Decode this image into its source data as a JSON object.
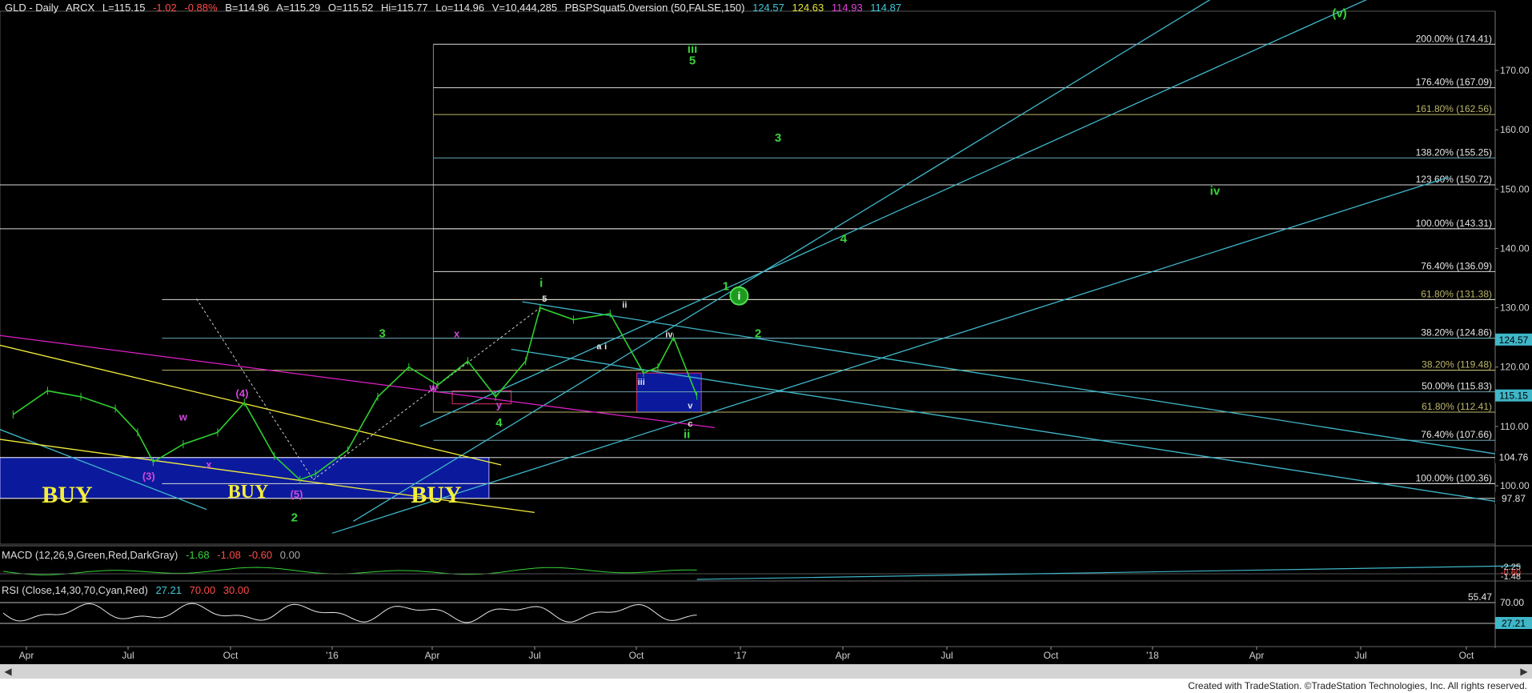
{
  "header": {
    "symbol": "GLD - Daily",
    "exchange": "ARCX",
    "last": "L=115.15",
    "change": "-1.02",
    "change_pct": "-0.88%",
    "bid": "B=114.96",
    "ask": "A=115.29",
    "open": "O=115.52",
    "high": "Hi=115.77",
    "low": "Lo=114.96",
    "volume": "V=10,444,285",
    "indicator": "PBSPSquat5.0version (50,FALSE,150)",
    "ind_values": [
      "124.57",
      "124.63",
      "114.93",
      "114.87"
    ]
  },
  "colors": {
    "background": "#000000",
    "price_bars": "#2fd02f",
    "channel": "#3fb7c9",
    "fib_white": "#d9d9d9",
    "fib_gold": "#bdb76b",
    "trend_yellow": "#f4ee3a",
    "trend_magenta": "#e020c8",
    "buy_box": "#0b1a9c",
    "wave_green": "#39d439",
    "wave_magenta": "#d04ad8",
    "rsi_line": "#e6e6e6"
  },
  "chart_data": {
    "type": "line",
    "title": "GLD - Daily",
    "series": [
      {
        "name": "GLD",
        "x": [
          "2015-03-20",
          "2015-04-20",
          "2015-05-20",
          "2015-06-20",
          "2015-07-10",
          "2015-07-24",
          "2015-08-20",
          "2015-09-20",
          "2015-10-14",
          "2015-11-10",
          "2015-12-03",
          "2015-12-17",
          "2016-01-15",
          "2016-02-11",
          "2016-03-10",
          "2016-04-05",
          "2016-05-02",
          "2016-05-27",
          "2016-06-23",
          "2016-07-06",
          "2016-08-05",
          "2016-09-07",
          "2016-10-07",
          "2016-10-20",
          "2016-11-03",
          "2016-11-24"
        ],
        "values": [
          112,
          116,
          115,
          113,
          109,
          104,
          107,
          109,
          114,
          105,
          101,
          102,
          106,
          115,
          120,
          117,
          121,
          115,
          121,
          130,
          128,
          129,
          119,
          120,
          125,
          115.15
        ]
      }
    ],
    "xlabel": "",
    "ylabel": "",
    "ylim": [
      90,
      180
    ],
    "x_ticks": [
      "Apr",
      "Jul",
      "Oct",
      "'16",
      "Apr",
      "Jul",
      "Oct",
      "'17",
      "Apr",
      "Jul",
      "Oct",
      "'18",
      "Apr",
      "Jul",
      "Oct"
    ],
    "y_ticks": [
      "100.00",
      "110.00",
      "120.00",
      "130.00",
      "140.00",
      "150.00",
      "160.00",
      "170.00"
    ],
    "fib_levels": [
      {
        "label": "200.00% (174.41)",
        "value": 174.41
      },
      {
        "label": "176.40% (167.09)",
        "value": 167.09
      },
      {
        "label": "161.80% (162.56)",
        "value": 162.56
      },
      {
        "label": "138.20% (155.25)",
        "value": 155.25
      },
      {
        "label": "123.60% (150.72)",
        "value": 150.72
      },
      {
        "label": "100.00% (143.31)",
        "value": 143.31
      },
      {
        "label": "76.40% (136.09)",
        "value": 136.09
      },
      {
        "label": "61.80% (131.38)",
        "value": 131.38
      },
      {
        "label": "38.20% (124.86)",
        "value": 124.86
      },
      {
        "label": "38.20% (119.48)",
        "value": 119.48
      },
      {
        "label": "50.00% (115.83)",
        "value": 115.83
      },
      {
        "label": "61.80% (112.41)",
        "value": 112.41
      },
      {
        "label": "76.40% (107.66)",
        "value": 107.66
      },
      {
        "label": "100.00% (100.36)",
        "value": 100.36
      }
    ],
    "price_tags": [
      {
        "label": "124.57",
        "value": 124.57
      },
      {
        "label": "115.15",
        "value": 115.15
      },
      {
        "label": "104.76",
        "value": 104.76
      },
      {
        "label": "97.87",
        "value": 97.87
      }
    ],
    "wave_labels_green": [
      {
        "text": "iii",
        "x": "2016-11-20",
        "y": 173
      },
      {
        "text": "5",
        "x": "2016-11-20",
        "y": 171
      },
      {
        "text": "(v)",
        "x": "2018-06-25",
        "y": 179
      },
      {
        "text": "3",
        "x": "2017-02-05",
        "y": 158
      },
      {
        "text": "iv",
        "x": "2018-03-05",
        "y": 149
      },
      {
        "text": "4",
        "x": "2017-04-05",
        "y": 141
      },
      {
        "text": "1",
        "x": "2016-12-20",
        "y": 133
      },
      {
        "text": "2",
        "x": "2017-01-18",
        "y": 125
      },
      {
        "text": "i",
        "x": "2016-07-07",
        "y": 133.5
      },
      {
        "text": "3",
        "x": "2016-02-15",
        "y": 125
      },
      {
        "text": "4",
        "x": "2016-05-30",
        "y": 110
      },
      {
        "text": "ii",
        "x": "2016-11-15",
        "y": 108
      },
      {
        "text": "2",
        "x": "2015-11-28",
        "y": 94
      }
    ],
    "wave_labels_white": [
      {
        "text": "5",
        "x": "2016-07-10",
        "y": 131
      },
      {
        "text": "ii",
        "x": "2016-09-20",
        "y": 130
      },
      {
        "text": "iv",
        "x": "2016-10-30",
        "y": 125
      },
      {
        "text": "a",
        "x": "2016-08-28",
        "y": 123
      },
      {
        "text": "i",
        "x": "2016-09-03",
        "y": 123
      },
      {
        "text": "iii",
        "x": "2016-10-05",
        "y": 117
      },
      {
        "text": "v",
        "x": "2016-11-18",
        "y": 113
      },
      {
        "text": "c",
        "x": "2016-11-18",
        "y": 110
      }
    ],
    "wave_labels_magenta": [
      {
        "text": "(4)",
        "x": "2015-10-12",
        "y": 115
      },
      {
        "text": "w",
        "x": "2015-08-20",
        "y": 111
      },
      {
        "text": "(3)",
        "x": "2015-07-20",
        "y": 101
      },
      {
        "text": "x",
        "x": "2015-09-12",
        "y": 103
      },
      {
        "text": "(5)",
        "x": "2015-11-30",
        "y": 98
      },
      {
        "text": "x",
        "x": "2016-04-22",
        "y": 125
      },
      {
        "text": "y",
        "x": "2016-05-30",
        "y": 113
      },
      {
        "text": "w",
        "x": "2016-04-01",
        "y": 116
      }
    ],
    "buy_labels": [
      "BUY",
      "BUY",
      "BUY"
    ],
    "macd": {
      "title": "MACD (12,26,9,Green,Red,DarkGray)",
      "values": [
        "-1.68",
        "-1.08",
        "-0.60",
        "0.00"
      ],
      "tags": [
        "-2.25",
        "-0.60",
        "-1.48"
      ]
    },
    "rsi": {
      "title": "RSI (Close,14,30,70,Cyan,Red)",
      "values": [
        "27.21",
        "70.00",
        "30.00"
      ],
      "tags": [
        "70.00",
        "55.47",
        "27.21"
      ]
    }
  },
  "footer": {
    "credit": "Created with TradeStation. ©TradeStation Technologies, Inc. All rights reserved."
  }
}
